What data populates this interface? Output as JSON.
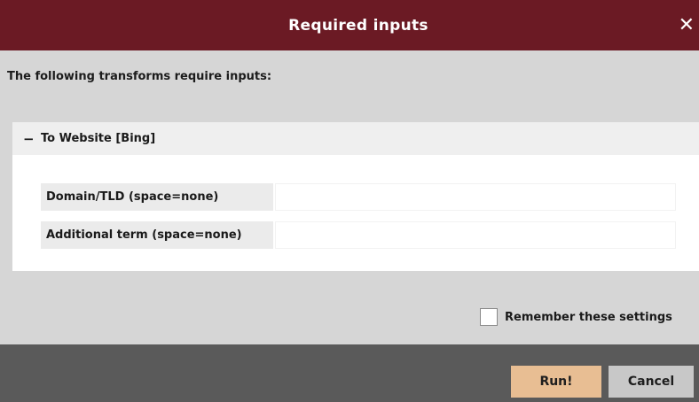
{
  "dialog": {
    "title": "Required inputs",
    "close_glyph": "✕",
    "intro": "The following transforms require inputs:"
  },
  "section": {
    "toggle_glyph": "−",
    "title": "To Website [Bing]",
    "fields": [
      {
        "label": "Domain/TLD (space=none)",
        "value": ""
      },
      {
        "label": "Additional term (space=none)",
        "value": ""
      }
    ]
  },
  "remember": {
    "label": "Remember these settings",
    "checked": false
  },
  "buttons": {
    "run_label": "Run!",
    "cancel_label": "Cancel"
  },
  "colors": {
    "titlebar": "#6b1a24",
    "run_button": "#e8be93",
    "cancel_button": "#c8c8c8",
    "footer": "#5a5a5a",
    "background": "#d6d6d6"
  },
  "icons": {
    "close": "close-icon",
    "collapse": "minus-icon"
  }
}
